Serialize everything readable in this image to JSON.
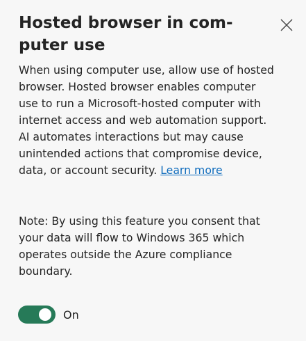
{
  "dialog": {
    "title_lines": [
      "Hosted browser in com-",
      "puter use"
    ],
    "description_lines": [
      "When using computer use, allow use of hosted",
      "browser. Hosted browser enables computer",
      "use to run a Microsoft-hosted computer with",
      "internet access and web automation support.",
      "AI automates interactions but may cause",
      "unintended actions that compromise device,"
    ],
    "description_last_line": "data, or account security. ",
    "learn_more_label": "Learn more",
    "note_lines": [
      "Note: By using this feature you consent that",
      "your data will flow to Windows 365 which",
      "operates outside the Azure compliance",
      "boundary."
    ],
    "toggle": {
      "state": "On",
      "checked": true,
      "color": "#267a58"
    },
    "close_icon": "close-icon"
  }
}
